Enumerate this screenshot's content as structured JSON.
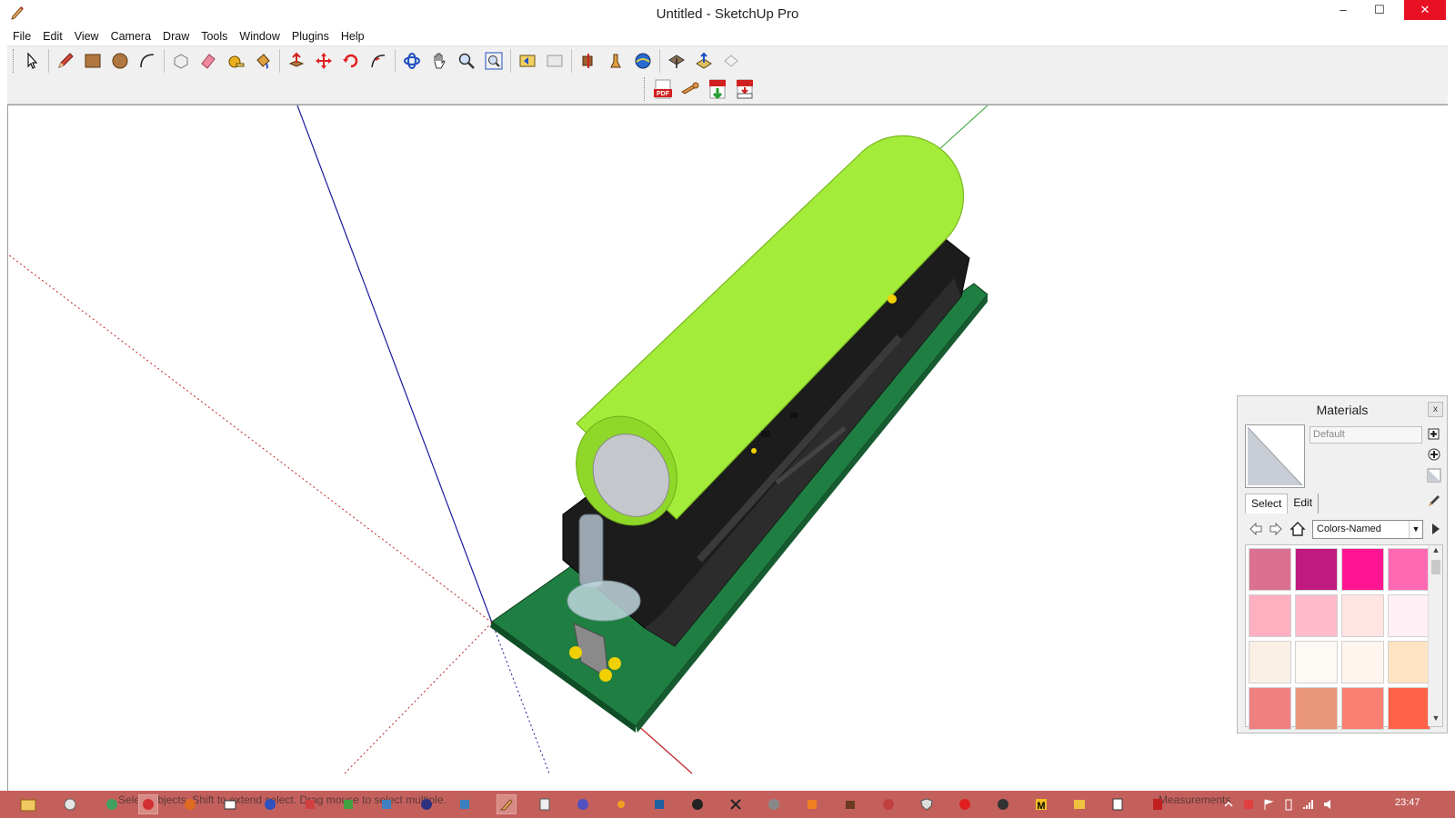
{
  "window": {
    "title": "Untitled - SketchUp Pro",
    "controls": {
      "minimize": "–",
      "maximize": "☐",
      "close": "✕"
    }
  },
  "menu": [
    "File",
    "Edit",
    "View",
    "Camera",
    "Draw",
    "Tools",
    "Window",
    "Plugins",
    "Help"
  ],
  "toolbar": {
    "row1": [
      "select-tool",
      "pencil-line-tool",
      "rectangle-tool",
      "circle-tool",
      "arc-tool",
      "make-component-tool",
      "eraser-tool",
      "tape-measure-tool",
      "paint-bucket-tool",
      "push-pull-tool",
      "move-tool",
      "rotate-tool",
      "follow-me-tool",
      "orbit-tool",
      "pan-tool",
      "zoom-tool",
      "zoom-extents-tool",
      "previous-view-tool",
      "next-view-tool",
      "position-camera-tool",
      "walk-tool",
      "look-around-tool",
      "add-location-tool",
      "toggle-terrain-tool",
      "photo-textures-tool"
    ],
    "row2": [
      "export-pdf-tool",
      "wrench-plugin-tool",
      "import-pdf-tool",
      "pdf-html-tool"
    ]
  },
  "materials_panel": {
    "title": "Materials",
    "close_label": "x",
    "material_name": "Default",
    "tabs": {
      "select": "Select",
      "edit": "Edit"
    },
    "library": "Colors-Named",
    "swatches": [
      "#dc7090",
      "#c01a80",
      "#ff1493",
      "#ff69b4",
      "#ffb0c0",
      "#ffbacb",
      "#ffe4e1",
      "#fff0f5",
      "#faf0e6",
      "#fdf9f5",
      "#fff5ee",
      "#ffe4c4",
      "#f08080",
      "#e9967a",
      "#fa8072",
      "#ff6347"
    ]
  },
  "statusbar": {
    "hint": "Select objects. Shift to extend select. Drag mouse to select multiple.",
    "measurements_label": "Measurements"
  },
  "taskbar": {
    "clock": "23:47"
  },
  "colors": {
    "close_button": "#e81123",
    "taskbar": "#c4605c",
    "battery": "#a6ee3c",
    "pcb": "#1d7a3e",
    "holder": "#1c1c1c"
  }
}
